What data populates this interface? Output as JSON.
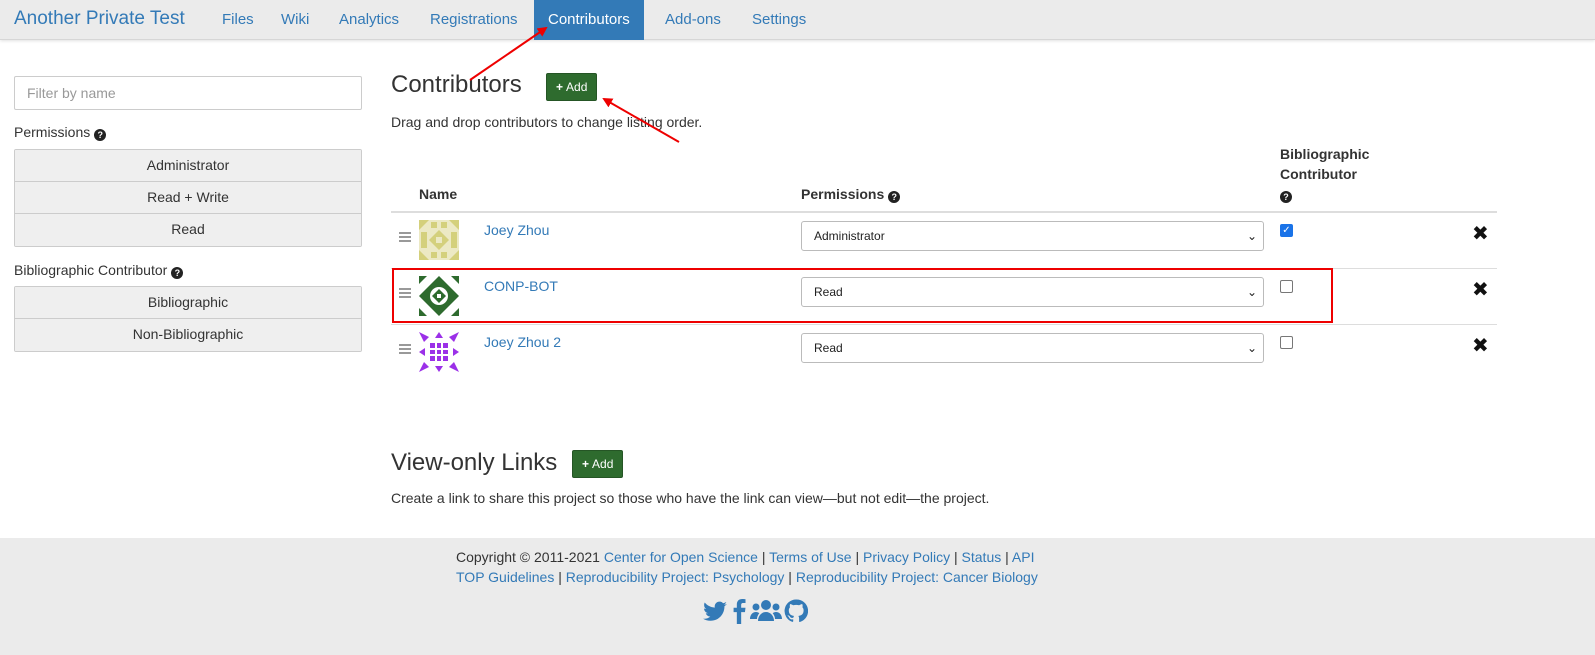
{
  "nav": {
    "title": "Another Private Test",
    "items": [
      {
        "label": "Files"
      },
      {
        "label": "Wiki"
      },
      {
        "label": "Analytics"
      },
      {
        "label": "Registrations"
      },
      {
        "label": "Contributors",
        "active": true
      },
      {
        "label": "Add-ons"
      },
      {
        "label": "Settings"
      }
    ]
  },
  "sidebar": {
    "filter_placeholder": "Filter by name",
    "permissions_label": "Permissions",
    "permission_filters": [
      "Administrator",
      "Read + Write",
      "Read"
    ],
    "bibliographic_label": "Bibliographic Contributor",
    "bibliographic_filters": [
      "Bibliographic",
      "Non-Bibliographic"
    ]
  },
  "contributors": {
    "title": "Contributors",
    "add_label": "Add",
    "help_text": "Drag and drop contributors to change listing order.",
    "columns": {
      "name": "Name",
      "permissions": "Permissions",
      "bibliographic_line1": "Bibliographic",
      "bibliographic_line2": "Contributor"
    },
    "rows": [
      {
        "name": "Joey Zhou",
        "permission": "Administrator",
        "bibliographic": true,
        "avatar_color": "#d4d07c"
      },
      {
        "name": "CONP-BOT",
        "permission": "Read",
        "bibliographic": false,
        "avatar_color": "#2e6b2e"
      },
      {
        "name": "Joey Zhou 2",
        "permission": "Read",
        "bibliographic": false,
        "avatar_color": "#9b30e8"
      }
    ]
  },
  "view_only": {
    "title": "View-only Links",
    "add_label": "Add",
    "help_text": "Create a link to share this project so those who have the link can view—but not edit—the project."
  },
  "footer": {
    "copyright": "Copyright © 2011-2021",
    "line1_links": [
      "Center for Open Science",
      "Terms of Use",
      "Privacy Policy",
      "Status",
      "API"
    ],
    "line2_links": [
      "TOP Guidelines",
      "Reproducibility Project: Psychology",
      "Reproducibility Project: Cancer Biology"
    ],
    "separator": "|",
    "social_icons": [
      "twitter-icon",
      "facebook-icon",
      "group-icon",
      "github-icon"
    ]
  },
  "colors": {
    "link": "#337ab7",
    "add_button": "#2e6b2e",
    "highlight": "#ee0000",
    "checkbox_checked": "#1a73e8"
  }
}
